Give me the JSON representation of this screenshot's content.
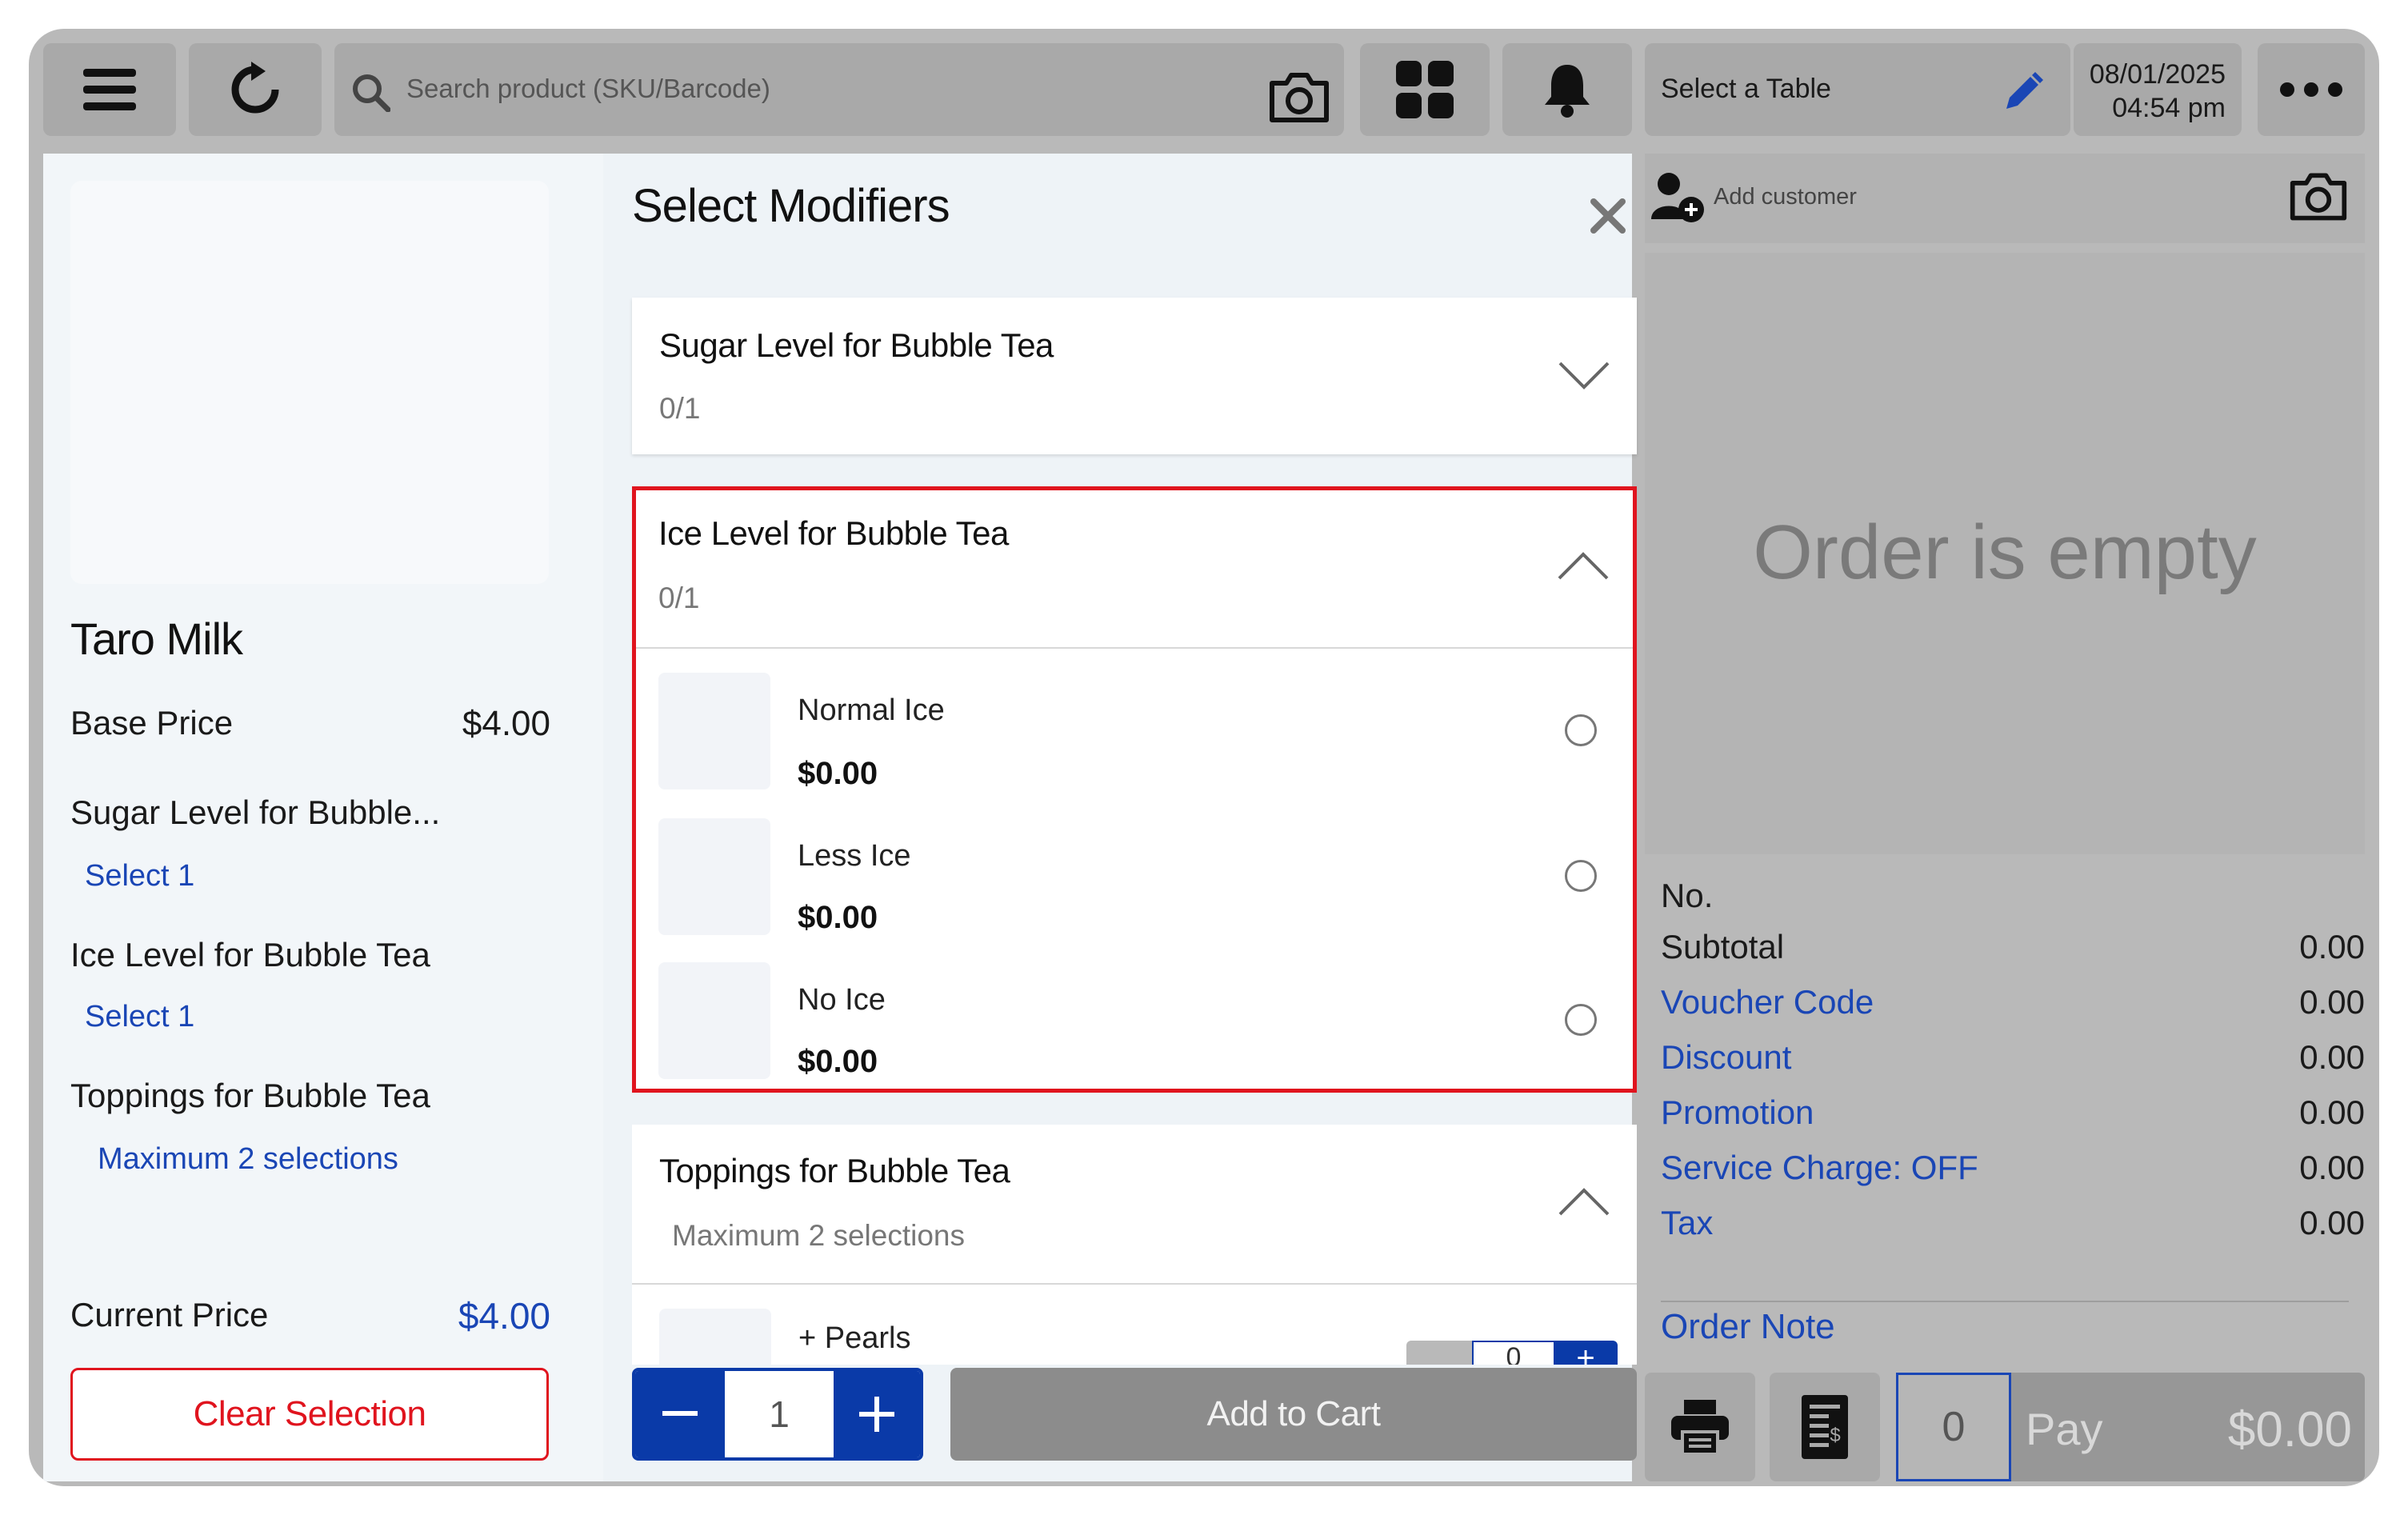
{
  "header": {
    "search_placeholder": "Search product (SKU/Barcode)",
    "table_label": "Select a Table",
    "date": "08/01/2025",
    "time": "04:54 pm"
  },
  "product": {
    "name": "Taro Milk",
    "base_price_label": "Base Price",
    "base_price": "$4.00",
    "modifier_summary": [
      {
        "name": "Sugar Level for Bubble...",
        "hint": "Select 1"
      },
      {
        "name": "Ice Level for Bubble Tea",
        "hint": "Select 1"
      },
      {
        "name": "Toppings for Bubble Tea",
        "hint": "Maximum 2 selections"
      }
    ],
    "current_price_label": "Current Price",
    "current_price": "$4.00",
    "clear_label": "Clear Selection"
  },
  "modifiers": {
    "title": "Select Modifiers",
    "groups": [
      {
        "title": "Sugar Level for Bubble Tea",
        "count": "0/1"
      },
      {
        "title": "Ice Level for Bubble Tea",
        "count": "0/1",
        "options": [
          {
            "name": "Normal Ice",
            "price": "$0.00"
          },
          {
            "name": "Less Ice",
            "price": "$0.00"
          },
          {
            "name": "No Ice",
            "price": "$0.00"
          }
        ]
      },
      {
        "title": "Toppings for Bubble Tea",
        "count": "Maximum 2 selections",
        "options": [
          {
            "name": "+ Pearls",
            "qty": "0"
          }
        ]
      }
    ],
    "quantity": "1",
    "add_to_cart": "Add to Cart"
  },
  "order": {
    "add_customer": "Add customer",
    "empty_text": "Order is empty",
    "no_label": "No.",
    "rows": [
      {
        "label": "Subtotal",
        "value": "0.00"
      },
      {
        "label": "Voucher Code",
        "value": "0.00"
      },
      {
        "label": "Discount",
        "value": "0.00"
      },
      {
        "label": "Promotion",
        "value": "0.00"
      },
      {
        "label": "Service Charge: OFF",
        "value": "0.00"
      },
      {
        "label": "Tax",
        "value": "0.00"
      }
    ],
    "order_note": "Order Note",
    "count": "0",
    "pay_label": "Pay",
    "pay_amount": "$0.00"
  },
  "colors": {
    "accent": "#0a3aa8",
    "danger": "#e0141e",
    "link": "#1a46b5"
  }
}
